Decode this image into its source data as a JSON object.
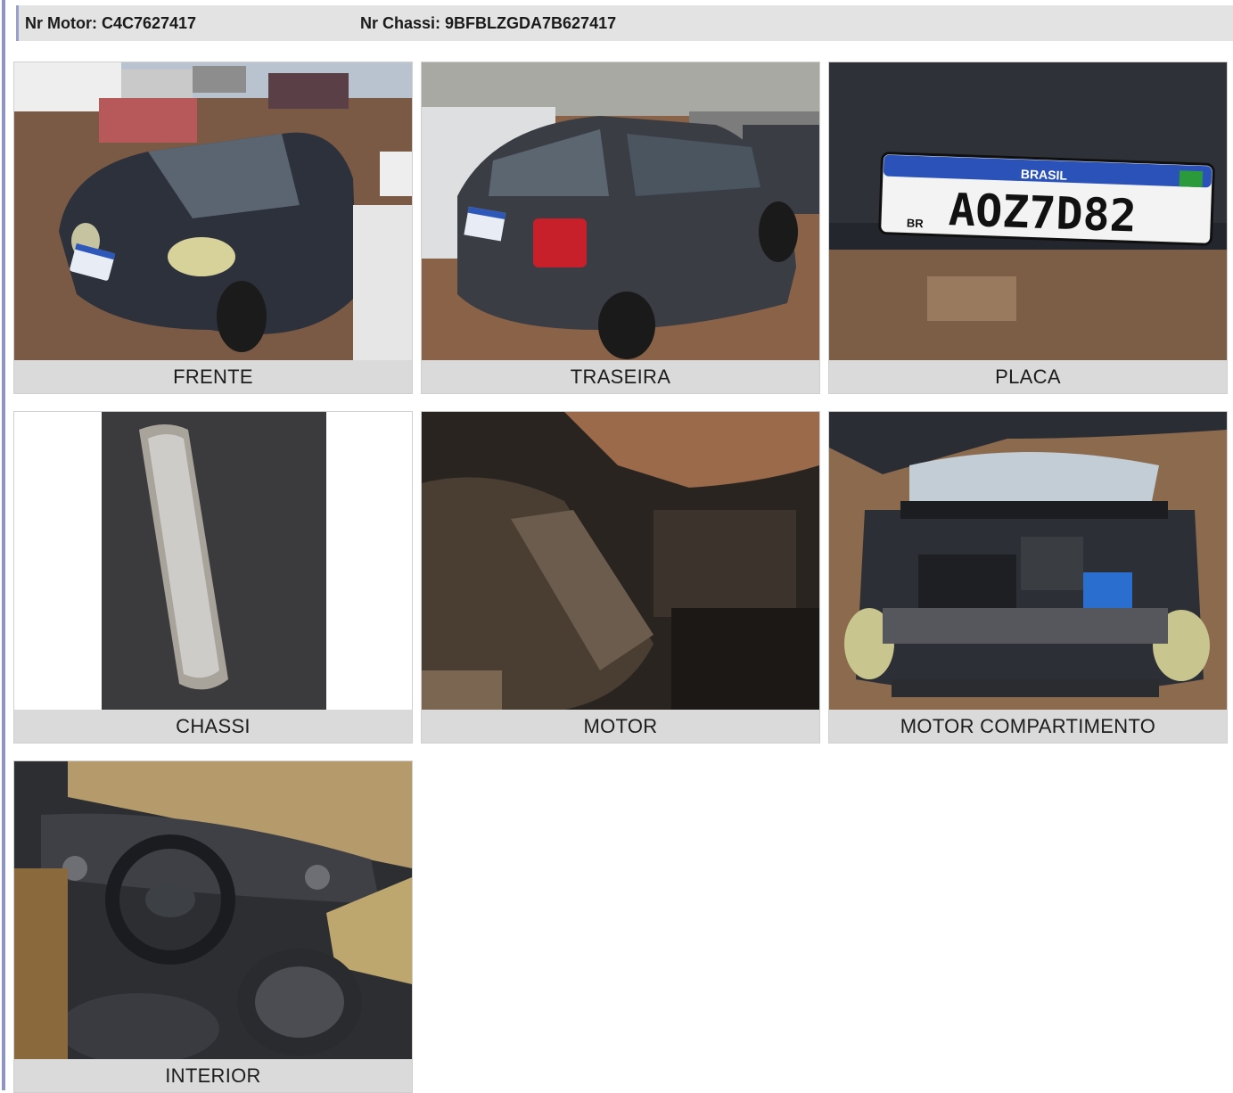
{
  "header": {
    "motor_label": "Nr Motor: C4C7627417",
    "chassi_label": "Nr Chassi: 9BFBLZGDA7B627417"
  },
  "photos": [
    {
      "caption": "FRENTE",
      "icon": "car-front-photo"
    },
    {
      "caption": "TRASEIRA",
      "icon": "car-rear-photo"
    },
    {
      "caption": "PLACA",
      "icon": "license-plate-photo"
    },
    {
      "caption": "CHASSI",
      "icon": "chassis-stamp-photo"
    },
    {
      "caption": "MOTOR",
      "icon": "engine-block-photo"
    },
    {
      "caption": "MOTOR COMPARTIMENTO",
      "icon": "engine-bay-photo"
    },
    {
      "caption": "INTERIOR",
      "icon": "interior-photo"
    }
  ],
  "plate": {
    "country": "BRASIL",
    "number": "AOZ7D82",
    "prefix": "BR"
  },
  "colors": {
    "header_bg": "#e3e3e3",
    "caption_bg": "#dadada",
    "accent_rule": "#8f95c2"
  }
}
